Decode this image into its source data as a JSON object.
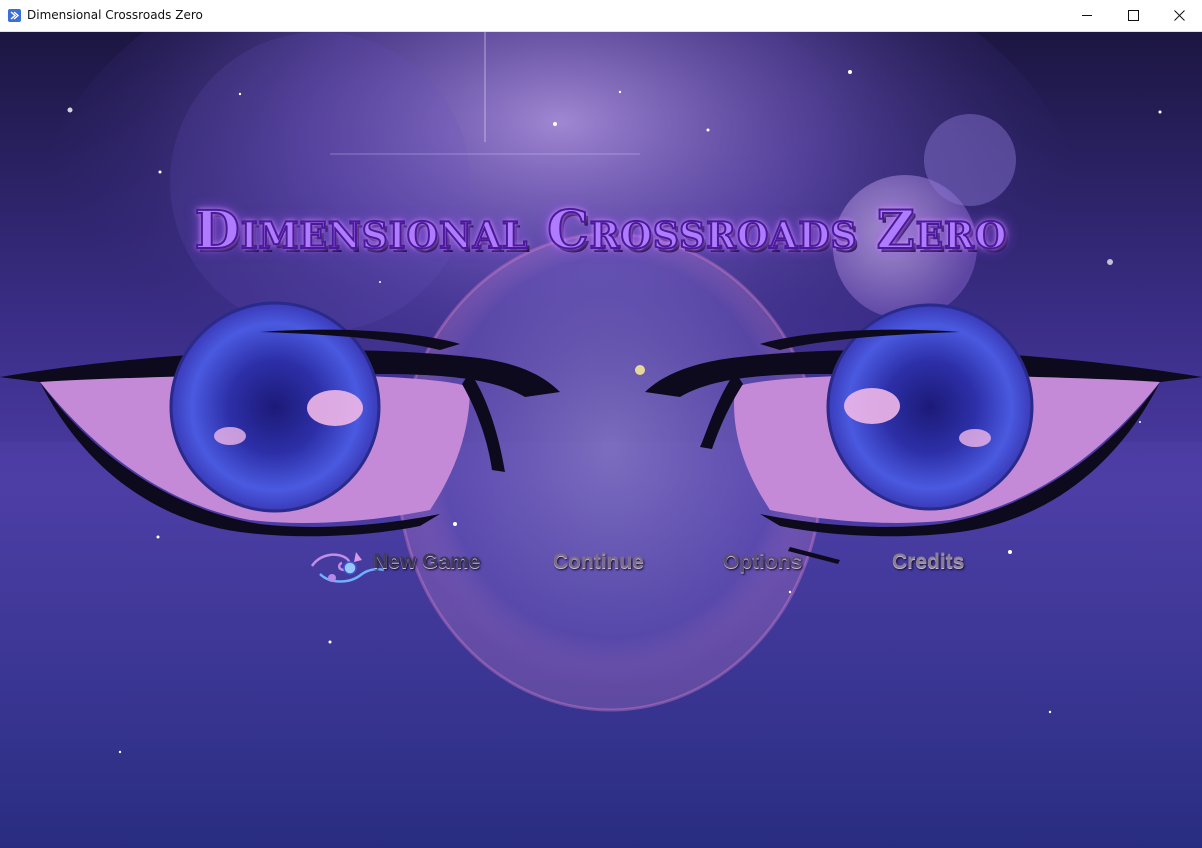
{
  "window": {
    "title": "Dimensional Crossroads Zero"
  },
  "game": {
    "title": "Dimensional Crossroads Zero"
  },
  "menu": {
    "new_game": "New Game",
    "continue": "Continue",
    "options": "Options",
    "credits": "Credits",
    "selected": "New Game"
  },
  "icons": {
    "app": "app-icon",
    "minimize": "minimize-icon",
    "maximize": "maximize-icon",
    "close": "close-icon",
    "cursor": "menu-cursor-ornament-icon"
  },
  "colors": {
    "sky_top": "#1a1440",
    "sky_mid": "#3b2a8a",
    "eye_iris": "#3f52d8",
    "eye_white": "#c48ad8",
    "title_glow": "#b07cff"
  }
}
